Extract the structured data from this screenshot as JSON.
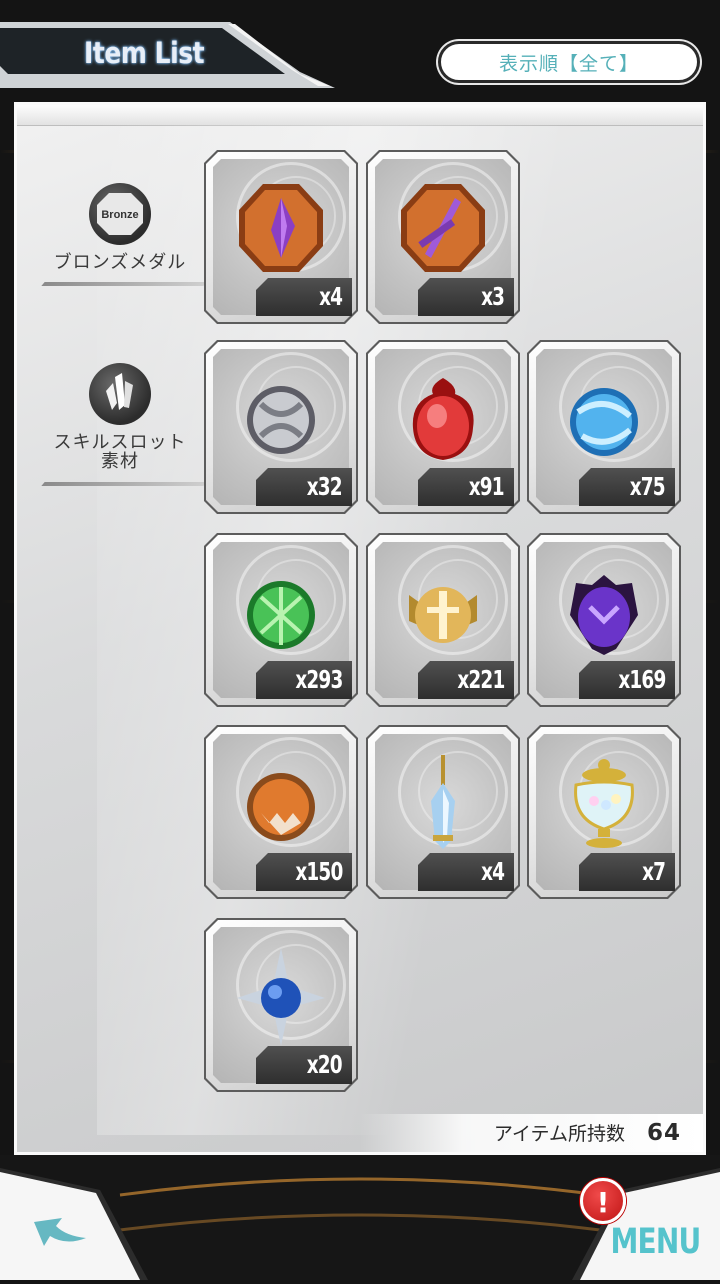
{
  "header": {
    "title": "Item List",
    "sort_button_label": "表示順【全て】"
  },
  "categories": [
    {
      "icon": "bronze-medal-icon",
      "badge_text": "Bronze",
      "label": "ブロンズメダル"
    },
    {
      "icon": "crystal-icon",
      "label_line1": "スキルスロット",
      "label_line2": "素材"
    }
  ],
  "items": [
    {
      "icon": "bronze-medal-spear-icon",
      "count": "x4"
    },
    {
      "icon": "bronze-medal-sword-icon",
      "count": "x3"
    },
    {
      "icon": "silver-orb-icon",
      "count": "x32"
    },
    {
      "icon": "red-orb-icon",
      "count": "x91"
    },
    {
      "icon": "blue-orb-icon",
      "count": "x75"
    },
    {
      "icon": "green-orb-icon",
      "count": "x293"
    },
    {
      "icon": "gold-orb-icon",
      "count": "x221"
    },
    {
      "icon": "purple-orb-icon",
      "count": "x169"
    },
    {
      "icon": "orange-orb-icon",
      "count": "x150"
    },
    {
      "icon": "crystal-pendant-icon",
      "count": "x4"
    },
    {
      "icon": "gem-bowl-icon",
      "count": "x7"
    },
    {
      "icon": "blue-star-orb-icon",
      "count": "x20"
    }
  ],
  "footer": {
    "owned_label": "アイテム所持数",
    "owned_value": "64"
  },
  "nav": {
    "back_icon": "back-arrow-icon",
    "menu_label": "MENU",
    "alert_text": "!"
  },
  "colors": {
    "accent": "#55c3cc",
    "bronze": "#d2702e",
    "alert": "#d22020"
  }
}
